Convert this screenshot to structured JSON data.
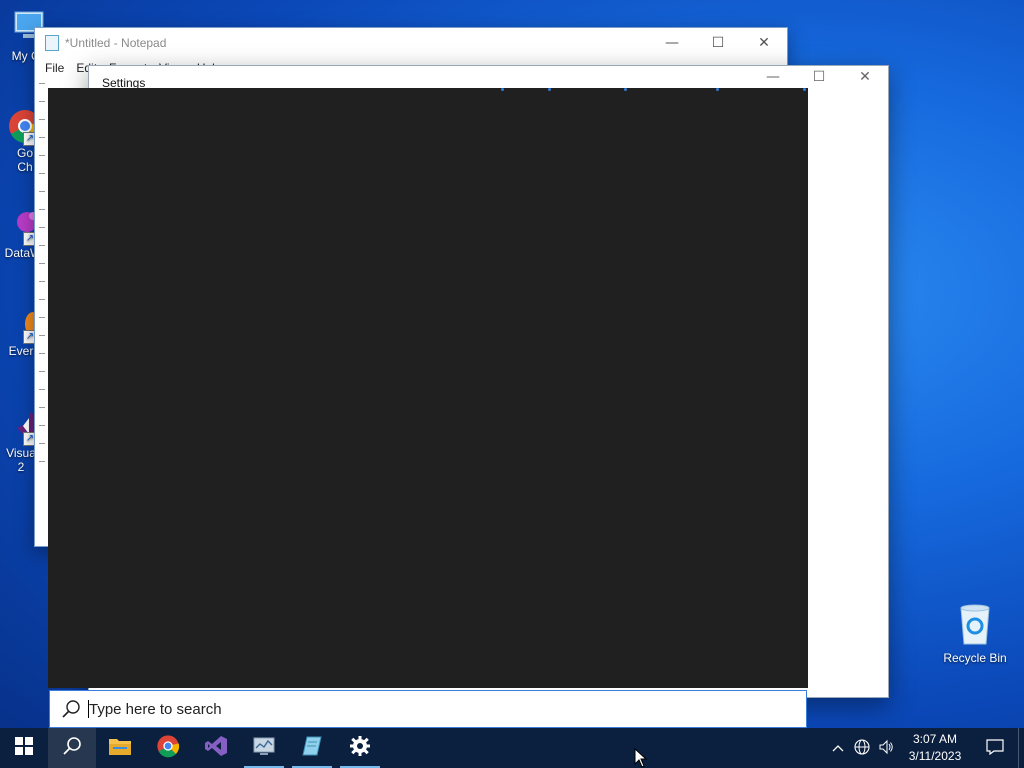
{
  "desktop": {
    "icons": [
      {
        "label": "My Co"
      },
      {
        "label": "Go\nCh"
      },
      {
        "label": "DataW"
      },
      {
        "label": "Ever"
      },
      {
        "label": "Visua\n2"
      }
    ],
    "recycle_bin": {
      "label": "Recycle Bin"
    }
  },
  "notepad": {
    "title": "*Untitled - Notepad",
    "menu": [
      "File",
      "Edit",
      "Format",
      "View",
      "Help"
    ],
    "controls": {
      "minimize": "—",
      "maximize": "☐",
      "close": "✕"
    }
  },
  "settings": {
    "title": "Settings",
    "controls": {
      "minimize": "—",
      "maximize": "☐",
      "close": "✕"
    }
  },
  "search": {
    "placeholder": "Type here to search"
  },
  "taskbar": {
    "apps": [
      {
        "name": "file-explorer"
      },
      {
        "name": "chrome"
      },
      {
        "name": "visual-studio"
      },
      {
        "name": "task-app"
      },
      {
        "name": "notepad"
      },
      {
        "name": "settings"
      }
    ],
    "clock": {
      "time": "3:07 AM",
      "date": "3/11/2023"
    }
  },
  "colors": {
    "accent": "#0078d7",
    "flyout_bg": "#202020",
    "taskbar_bg": "#0b1f3f"
  }
}
